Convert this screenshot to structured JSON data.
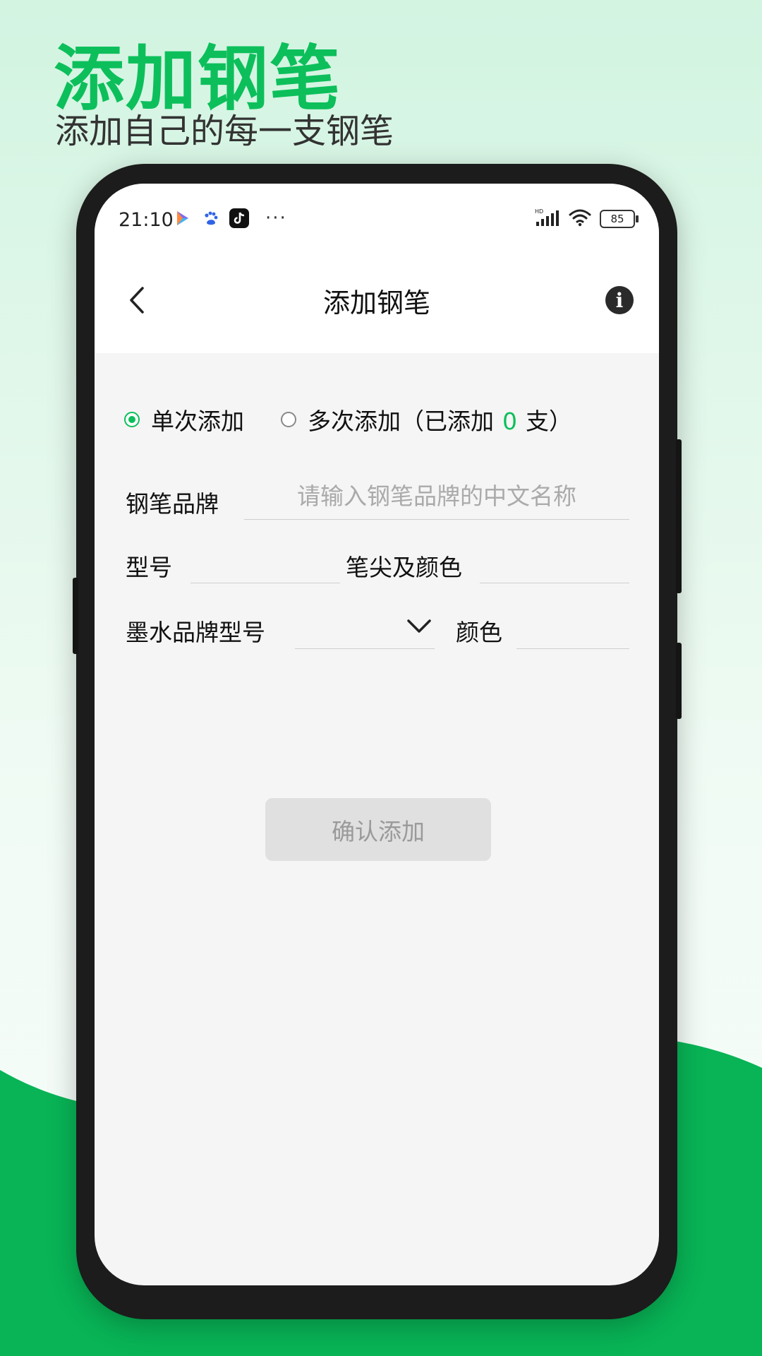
{
  "promo": {
    "title": "添加钢笔",
    "subtitle": "添加自己的每一支钢笔"
  },
  "status_bar": {
    "time": "21:10",
    "notification_icons": [
      "play-store-icon",
      "baidu-icon",
      "tiktok-icon"
    ],
    "more_dots": "···",
    "signal_label": "HD",
    "battery_level": "85"
  },
  "app_bar": {
    "title": "添加钢笔",
    "back_icon": "chevron-left-icon",
    "info_icon": "info-icon",
    "info_glyph": "i"
  },
  "mode": {
    "single_label": "单次添加",
    "multi_label": "多次添加",
    "count_prefix": "（已添加",
    "count_value": "0",
    "count_suffix": "支）",
    "selected": "single"
  },
  "form": {
    "brand_label": "钢笔品牌",
    "brand_placeholder": "请输入钢笔品牌的中文名称",
    "brand_value": "",
    "model_label": "型号",
    "model_value": "",
    "nib_color_label": "笔尖及颜色",
    "nib_color_value": "",
    "ink_label": "墨水品牌型号",
    "ink_value": "",
    "ink_color_label": "颜色",
    "ink_color_value": ""
  },
  "confirm_button": "确认添加",
  "colors": {
    "accent": "#0cbf5b",
    "button_disabled_bg": "#e0e0e0",
    "button_disabled_text": "#9a9a9a"
  }
}
